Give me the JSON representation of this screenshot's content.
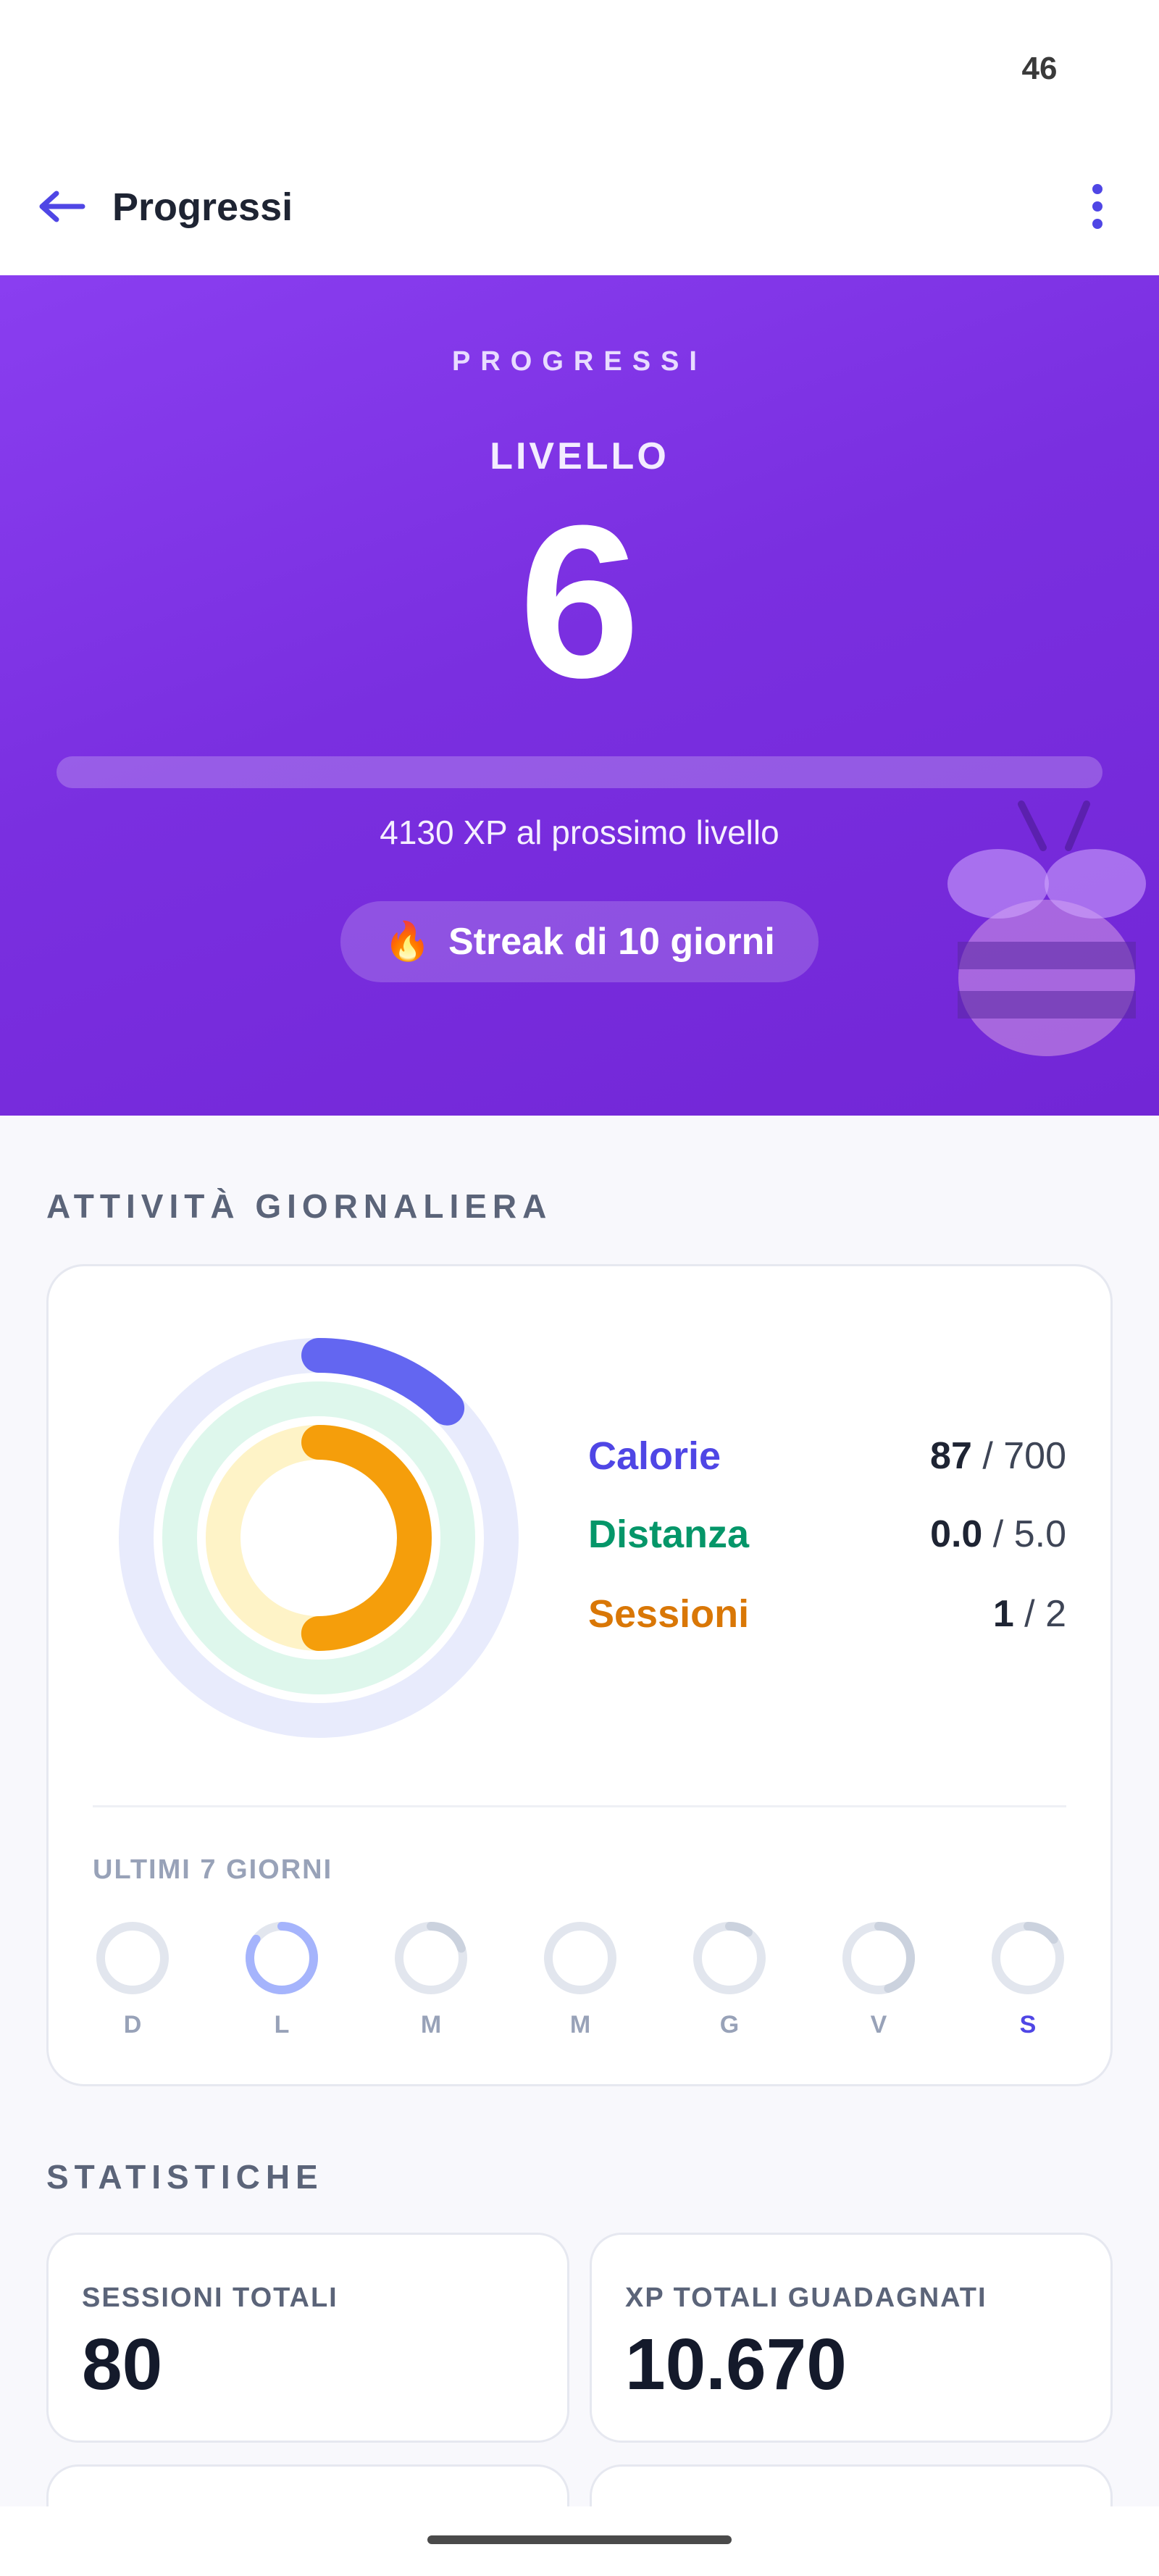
{
  "status_bar": {
    "time": "46"
  },
  "app_bar": {
    "title": "Progressi",
    "back_icon": "arrow-left-icon",
    "more_icon": "more-vertical-icon"
  },
  "hero": {
    "kicker": "PROGRESSI",
    "level_label": "LIVELLO",
    "level": "6",
    "xp_progress_fraction": 0.0,
    "xp_text": "4130 XP al prossimo livello",
    "streak_icon": "🔥",
    "streak_text": "Streak di 10 giorni",
    "mascot_icon": "bee-mascot-icon"
  },
  "activity": {
    "section_title": "ATTIVITÀ GIORNALIERA",
    "metrics": [
      {
        "name": "Calorie",
        "current": "87",
        "separator": " / ",
        "goal": "700",
        "progress": 0.124,
        "color": "#4f46e5",
        "ring_color": "#6366f1",
        "track_color": "#e8ebfc"
      },
      {
        "name": "Distanza",
        "current": "0.0",
        "separator": " / ",
        "goal": "5.0",
        "progress": 0.0,
        "color": "#059669",
        "ring_color": "#10b981",
        "track_color": "#def7ec"
      },
      {
        "name": "Sessioni",
        "current": "1",
        "separator": " / ",
        "goal": "2",
        "progress": 0.5,
        "color": "#d97706",
        "ring_color": "#f59e0b",
        "track_color": "#fef3c7"
      }
    ],
    "week_label": "ULTIMI 7 GIORNI",
    "days": [
      {
        "letter": "D",
        "progress": 0.0,
        "active": false
      },
      {
        "letter": "L",
        "progress": 0.85,
        "active": false
      },
      {
        "letter": "M",
        "progress": 0.2,
        "active": false
      },
      {
        "letter": "M",
        "progress": 0.0,
        "active": false
      },
      {
        "letter": "G",
        "progress": 0.1,
        "active": false
      },
      {
        "letter": "V",
        "progress": 0.45,
        "active": false
      },
      {
        "letter": "S",
        "progress": 0.15,
        "active": true
      }
    ]
  },
  "stats": {
    "section_title": "STATISTICHE",
    "cards": [
      {
        "label": "SESSIONI TOTALI",
        "value": "80"
      },
      {
        "label": "XP TOTALI GUADAGNATI",
        "value": "10.670"
      }
    ]
  },
  "colors": {
    "hero_purple": "#7a2fe0",
    "accent": "#4f46e5",
    "day_active": "#4f46e5"
  }
}
